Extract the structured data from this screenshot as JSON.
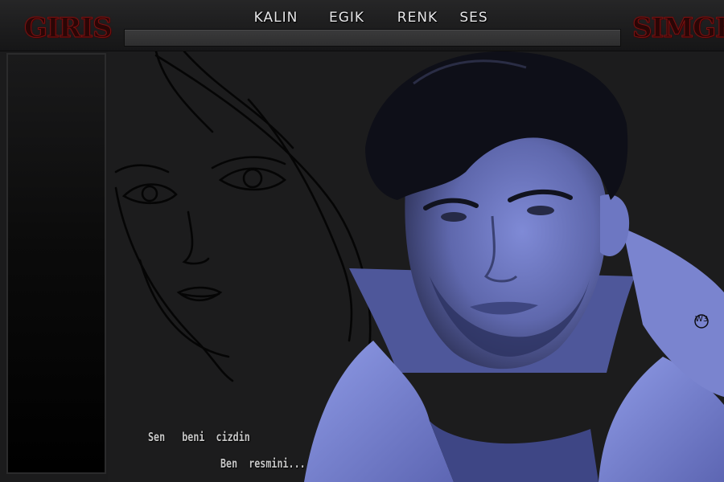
{
  "header": {
    "login_label": "GIRIS",
    "emoticon_label": "SIMGE",
    "format_menu": [
      {
        "id": "kalin",
        "label": "KALIN"
      },
      {
        "id": "egik",
        "label": "EGIK"
      },
      {
        "id": "renk",
        "label": "RENK"
      },
      {
        "id": "ses",
        "label": "SES"
      }
    ],
    "message_input": {
      "value": "",
      "placeholder": ""
    }
  },
  "artwork": {
    "lyrics": [
      "Sen   beni  cizdin",
      "Ben  resmini..."
    ],
    "signature": "W3"
  },
  "colors": {
    "background": "#1b1b1c",
    "topbar": "#222223",
    "accent_red": "#7a1111",
    "photo_tint": "#6f79c4"
  }
}
